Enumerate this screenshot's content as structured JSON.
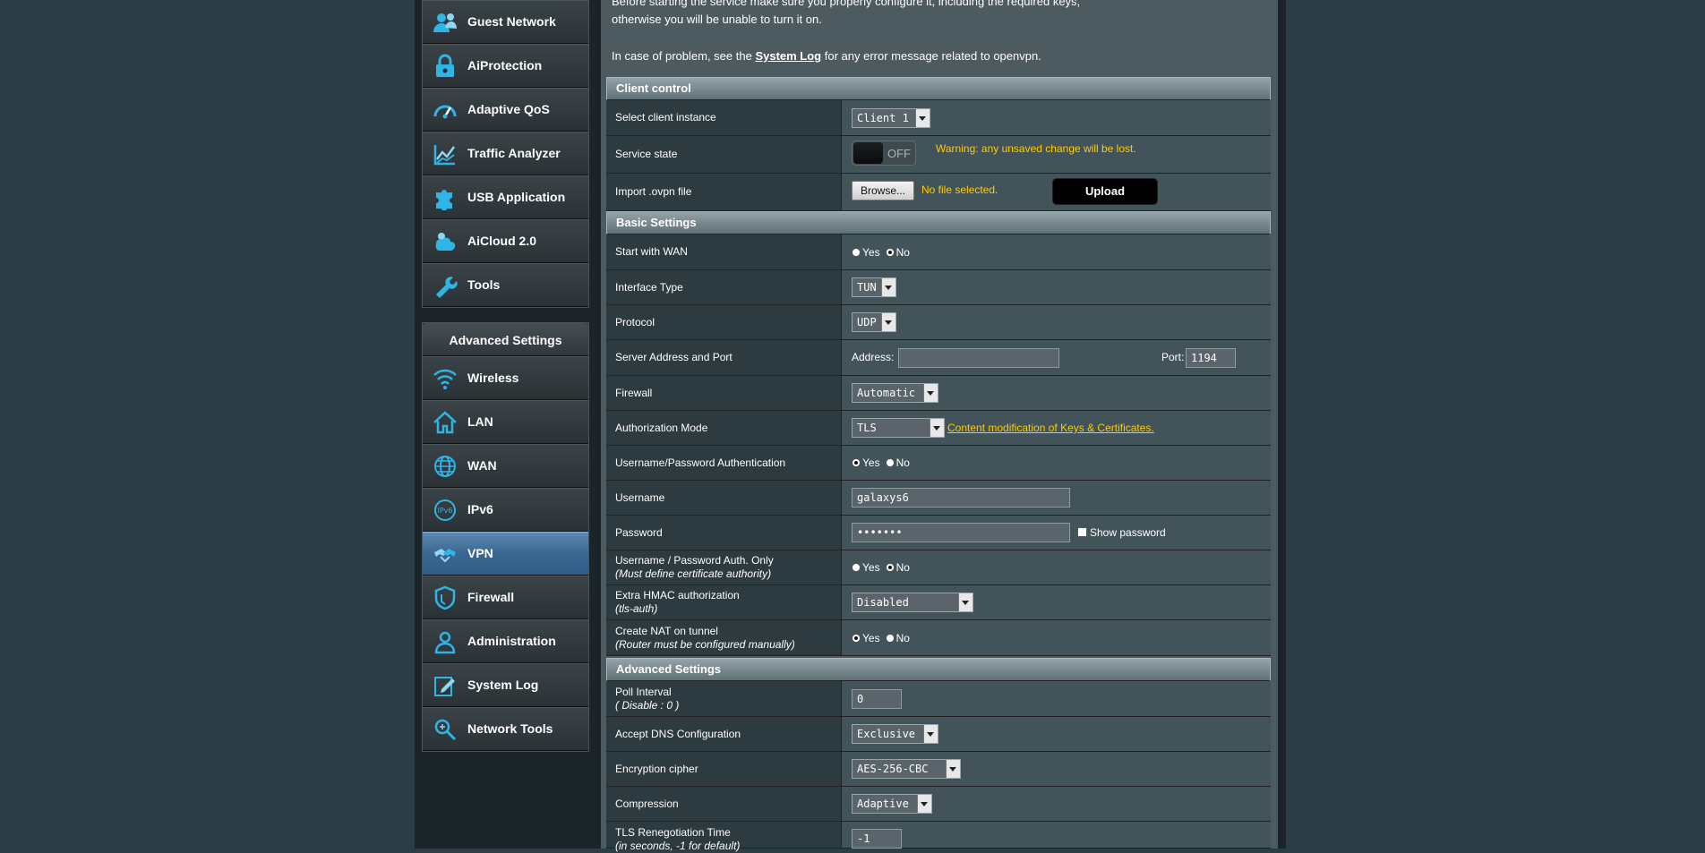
{
  "sidebar": {
    "items": [
      {
        "label": "Guest Network",
        "icon": "guest-network-icon"
      },
      {
        "label": "AiProtection",
        "icon": "lock-icon"
      },
      {
        "label": "Adaptive QoS",
        "icon": "speedometer-icon"
      },
      {
        "label": "Traffic Analyzer",
        "icon": "traffic-chart-icon"
      },
      {
        "label": "USB Application",
        "icon": "puzzle-icon"
      },
      {
        "label": "AiCloud 2.0",
        "icon": "cloud-icon"
      },
      {
        "label": "Tools",
        "icon": "wrench-icon"
      }
    ],
    "advanced_header": "Advanced Settings",
    "advanced_items": [
      {
        "label": "Wireless",
        "icon": "wifi-icon"
      },
      {
        "label": "LAN",
        "icon": "home-icon"
      },
      {
        "label": "WAN",
        "icon": "globe-icon"
      },
      {
        "label": "IPv6",
        "icon": "ipv6-icon"
      },
      {
        "label": "VPN",
        "icon": "vpn-icon"
      },
      {
        "label": "Firewall",
        "icon": "shield-icon"
      },
      {
        "label": "Administration",
        "icon": "user-icon"
      },
      {
        "label": "System Log",
        "icon": "edit-log-icon"
      },
      {
        "label": "Network Tools",
        "icon": "network-tools-icon"
      }
    ],
    "active": "VPN"
  },
  "intro": {
    "line1": "Before starting the service make sure you properly configure it, including the required keys,",
    "line2": "otherwise you will be unable to turn it on.",
    "line3_pre": "In case of problem, see the ",
    "line3_link": "System Log",
    "line3_post": " for any error message related to openvpn."
  },
  "client_control": {
    "header": "Client control",
    "select_instance": {
      "label": "Select client instance",
      "value": "Client 1"
    },
    "service_state": {
      "label": "Service state",
      "toggle": "OFF",
      "warning": "Warning: any unsaved change will be lost."
    },
    "import_file": {
      "label": "Import .ovpn file",
      "browse": "Browse...",
      "status": "No file selected.",
      "upload": "Upload"
    }
  },
  "basic": {
    "header": "Basic Settings",
    "start_with_wan": {
      "label": "Start with WAN",
      "yes": "Yes",
      "no": "No",
      "selected": "no"
    },
    "interface_type": {
      "label": "Interface Type",
      "value": "TUN"
    },
    "protocol": {
      "label": "Protocol",
      "value": "UDP"
    },
    "server": {
      "label": "Server Address and Port",
      "address_label": "Address:",
      "address": "",
      "port_label": "Port:",
      "port": "1194"
    },
    "firewall": {
      "label": "Firewall",
      "value": "Automatic"
    },
    "auth_mode": {
      "label": "Authorization Mode",
      "value": "TLS",
      "link": "Content modification of Keys & Certificates."
    },
    "userpass_auth": {
      "label": "Username/Password Authentication",
      "yes": "Yes",
      "no": "No",
      "selected": "yes"
    },
    "username": {
      "label": "Username",
      "value": "galaxys6"
    },
    "password": {
      "label": "Password",
      "value": "•••••••",
      "show": "Show password"
    },
    "userpass_only": {
      "label": "Username / Password Auth. Only",
      "sub": "(Must define certificate authority)",
      "yes": "Yes",
      "no": "No",
      "selected": "no"
    },
    "hmac": {
      "label": "Extra HMAC authorization",
      "sub": "(tls-auth)",
      "value": "Disabled"
    },
    "nat": {
      "label": "Create NAT on tunnel",
      "sub": "(Router must be configured manually)",
      "yes": "Yes",
      "no": "No",
      "selected": "yes"
    }
  },
  "advanced": {
    "header": "Advanced Settings",
    "poll": {
      "label": "Poll Interval",
      "sub": "( Disable : 0 )",
      "value": "0"
    },
    "dns": {
      "label": "Accept DNS Configuration",
      "value": "Exclusive"
    },
    "cipher": {
      "label": "Encryption cipher",
      "value": "AES-256-CBC"
    },
    "compression": {
      "label": "Compression",
      "value": "Adaptive"
    },
    "tls_reneg": {
      "label": "TLS Renegotiation Time",
      "sub": "(in seconds, -1 for default)",
      "value": "-1"
    }
  }
}
